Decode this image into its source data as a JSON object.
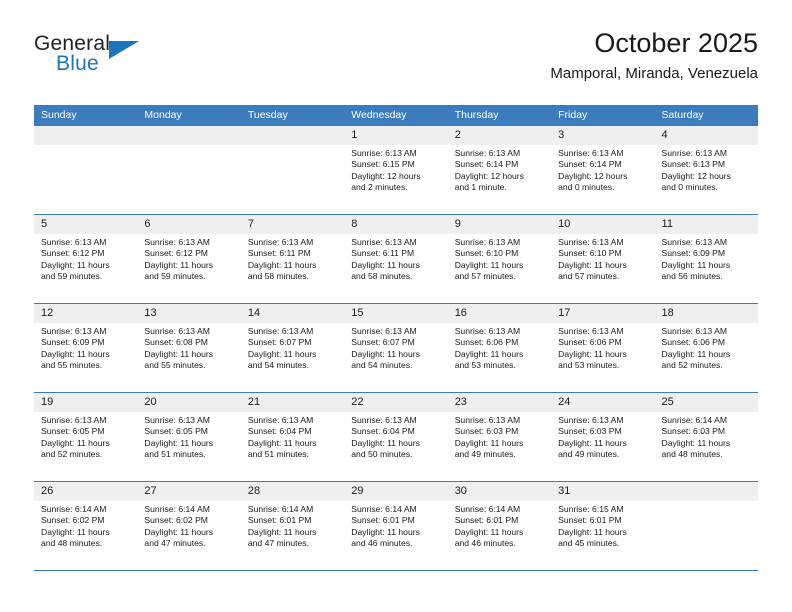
{
  "brand": {
    "name_part1": "General",
    "name_part2": "Blue",
    "flag_icon": "blue-flag-triangle",
    "color_dark": "#231f20",
    "color_blue": "#1b75bb"
  },
  "header": {
    "title": "October 2025",
    "subtitle": "Mamporal, Miranda, Venezuela"
  },
  "calendar": {
    "header_bg": "#3b7cbd",
    "daynum_bg": "#efefef",
    "weekdays": [
      "Sunday",
      "Monday",
      "Tuesday",
      "Wednesday",
      "Thursday",
      "Friday",
      "Saturday"
    ],
    "labels": {
      "sunrise": "Sunrise:",
      "sunset": "Sunset:",
      "daylight": "Daylight:"
    },
    "weeks": [
      [
        {
          "day": "",
          "empty": true
        },
        {
          "day": "",
          "empty": true
        },
        {
          "day": "",
          "empty": true
        },
        {
          "day": "1",
          "sunrise": "Sunrise: 6:13 AM",
          "sunset": "Sunset: 6:15 PM",
          "daylight_l1": "Daylight: 12 hours",
          "daylight_l2": "and 2 minutes."
        },
        {
          "day": "2",
          "sunrise": "Sunrise: 6:13 AM",
          "sunset": "Sunset: 6:14 PM",
          "daylight_l1": "Daylight: 12 hours",
          "daylight_l2": "and 1 minute."
        },
        {
          "day": "3",
          "sunrise": "Sunrise: 6:13 AM",
          "sunset": "Sunset: 6:14 PM",
          "daylight_l1": "Daylight: 12 hours",
          "daylight_l2": "and 0 minutes."
        },
        {
          "day": "4",
          "sunrise": "Sunrise: 6:13 AM",
          "sunset": "Sunset: 6:13 PM",
          "daylight_l1": "Daylight: 12 hours",
          "daylight_l2": "and 0 minutes."
        }
      ],
      [
        {
          "day": "5",
          "sunrise": "Sunrise: 6:13 AM",
          "sunset": "Sunset: 6:12 PM",
          "daylight_l1": "Daylight: 11 hours",
          "daylight_l2": "and 59 minutes."
        },
        {
          "day": "6",
          "sunrise": "Sunrise: 6:13 AM",
          "sunset": "Sunset: 6:12 PM",
          "daylight_l1": "Daylight: 11 hours",
          "daylight_l2": "and 59 minutes."
        },
        {
          "day": "7",
          "sunrise": "Sunrise: 6:13 AM",
          "sunset": "Sunset: 6:11 PM",
          "daylight_l1": "Daylight: 11 hours",
          "daylight_l2": "and 58 minutes."
        },
        {
          "day": "8",
          "sunrise": "Sunrise: 6:13 AM",
          "sunset": "Sunset: 6:11 PM",
          "daylight_l1": "Daylight: 11 hours",
          "daylight_l2": "and 58 minutes."
        },
        {
          "day": "9",
          "sunrise": "Sunrise: 6:13 AM",
          "sunset": "Sunset: 6:10 PM",
          "daylight_l1": "Daylight: 11 hours",
          "daylight_l2": "and 57 minutes."
        },
        {
          "day": "10",
          "sunrise": "Sunrise: 6:13 AM",
          "sunset": "Sunset: 6:10 PM",
          "daylight_l1": "Daylight: 11 hours",
          "daylight_l2": "and 57 minutes."
        },
        {
          "day": "11",
          "sunrise": "Sunrise: 6:13 AM",
          "sunset": "Sunset: 6:09 PM",
          "daylight_l1": "Daylight: 11 hours",
          "daylight_l2": "and 56 minutes."
        }
      ],
      [
        {
          "day": "12",
          "sunrise": "Sunrise: 6:13 AM",
          "sunset": "Sunset: 6:09 PM",
          "daylight_l1": "Daylight: 11 hours",
          "daylight_l2": "and 55 minutes."
        },
        {
          "day": "13",
          "sunrise": "Sunrise: 6:13 AM",
          "sunset": "Sunset: 6:08 PM",
          "daylight_l1": "Daylight: 11 hours",
          "daylight_l2": "and 55 minutes."
        },
        {
          "day": "14",
          "sunrise": "Sunrise: 6:13 AM",
          "sunset": "Sunset: 6:07 PM",
          "daylight_l1": "Daylight: 11 hours",
          "daylight_l2": "and 54 minutes."
        },
        {
          "day": "15",
          "sunrise": "Sunrise: 6:13 AM",
          "sunset": "Sunset: 6:07 PM",
          "daylight_l1": "Daylight: 11 hours",
          "daylight_l2": "and 54 minutes."
        },
        {
          "day": "16",
          "sunrise": "Sunrise: 6:13 AM",
          "sunset": "Sunset: 6:06 PM",
          "daylight_l1": "Daylight: 11 hours",
          "daylight_l2": "and 53 minutes."
        },
        {
          "day": "17",
          "sunrise": "Sunrise: 6:13 AM",
          "sunset": "Sunset: 6:06 PM",
          "daylight_l1": "Daylight: 11 hours",
          "daylight_l2": "and 53 minutes."
        },
        {
          "day": "18",
          "sunrise": "Sunrise: 6:13 AM",
          "sunset": "Sunset: 6:06 PM",
          "daylight_l1": "Daylight: 11 hours",
          "daylight_l2": "and 52 minutes."
        }
      ],
      [
        {
          "day": "19",
          "sunrise": "Sunrise: 6:13 AM",
          "sunset": "Sunset: 6:05 PM",
          "daylight_l1": "Daylight: 11 hours",
          "daylight_l2": "and 52 minutes."
        },
        {
          "day": "20",
          "sunrise": "Sunrise: 6:13 AM",
          "sunset": "Sunset: 6:05 PM",
          "daylight_l1": "Daylight: 11 hours",
          "daylight_l2": "and 51 minutes."
        },
        {
          "day": "21",
          "sunrise": "Sunrise: 6:13 AM",
          "sunset": "Sunset: 6:04 PM",
          "daylight_l1": "Daylight: 11 hours",
          "daylight_l2": "and 51 minutes."
        },
        {
          "day": "22",
          "sunrise": "Sunrise: 6:13 AM",
          "sunset": "Sunset: 6:04 PM",
          "daylight_l1": "Daylight: 11 hours",
          "daylight_l2": "and 50 minutes."
        },
        {
          "day": "23",
          "sunrise": "Sunrise: 6:13 AM",
          "sunset": "Sunset: 6:03 PM",
          "daylight_l1": "Daylight: 11 hours",
          "daylight_l2": "and 49 minutes."
        },
        {
          "day": "24",
          "sunrise": "Sunrise: 6:13 AM",
          "sunset": "Sunset: 6:03 PM",
          "daylight_l1": "Daylight: 11 hours",
          "daylight_l2": "and 49 minutes."
        },
        {
          "day": "25",
          "sunrise": "Sunrise: 6:14 AM",
          "sunset": "Sunset: 6:03 PM",
          "daylight_l1": "Daylight: 11 hours",
          "daylight_l2": "and 48 minutes."
        }
      ],
      [
        {
          "day": "26",
          "sunrise": "Sunrise: 6:14 AM",
          "sunset": "Sunset: 6:02 PM",
          "daylight_l1": "Daylight: 11 hours",
          "daylight_l2": "and 48 minutes."
        },
        {
          "day": "27",
          "sunrise": "Sunrise: 6:14 AM",
          "sunset": "Sunset: 6:02 PM",
          "daylight_l1": "Daylight: 11 hours",
          "daylight_l2": "and 47 minutes."
        },
        {
          "day": "28",
          "sunrise": "Sunrise: 6:14 AM",
          "sunset": "Sunset: 6:01 PM",
          "daylight_l1": "Daylight: 11 hours",
          "daylight_l2": "and 47 minutes."
        },
        {
          "day": "29",
          "sunrise": "Sunrise: 6:14 AM",
          "sunset": "Sunset: 6:01 PM",
          "daylight_l1": "Daylight: 11 hours",
          "daylight_l2": "and 46 minutes."
        },
        {
          "day": "30",
          "sunrise": "Sunrise: 6:14 AM",
          "sunset": "Sunset: 6:01 PM",
          "daylight_l1": "Daylight: 11 hours",
          "daylight_l2": "and 46 minutes."
        },
        {
          "day": "31",
          "sunrise": "Sunrise: 6:15 AM",
          "sunset": "Sunset: 6:01 PM",
          "daylight_l1": "Daylight: 11 hours",
          "daylight_l2": "and 45 minutes."
        },
        {
          "day": "",
          "empty": true
        }
      ]
    ]
  }
}
